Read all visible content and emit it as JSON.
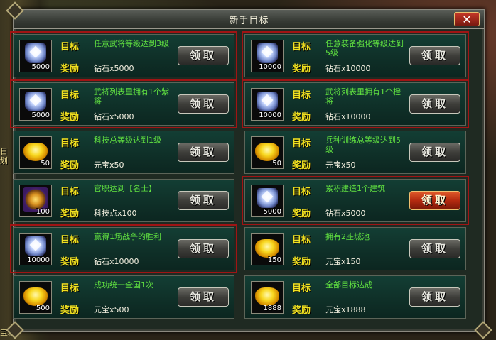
{
  "background": {
    "labels": [
      "日",
      "划",
      "宝箱"
    ]
  },
  "dialog": {
    "title": "新手目标",
    "close_label": "✕"
  },
  "labels": {
    "goal": "目标",
    "reward": "奖励"
  },
  "tasks": [
    {
      "icon": "diamond-icon",
      "qty": "5000",
      "goal": "任意武将等级达到3级",
      "reward": "钻石x5000",
      "button": "领取",
      "highlighted": true,
      "active": false
    },
    {
      "icon": "diamond-icon",
      "qty": "10000",
      "goal": "任意装备强化等级达到5级",
      "reward": "钻石x10000",
      "button": "领取",
      "highlighted": true,
      "active": false
    },
    {
      "icon": "diamond-icon",
      "qty": "5000",
      "goal": "武将列表里拥有1个紫将",
      "reward": "钻石x5000",
      "button": "领取",
      "highlighted": true,
      "active": false
    },
    {
      "icon": "diamond-icon",
      "qty": "10000",
      "goal": "武将列表里拥有1个橙将",
      "reward": "钻石x10000",
      "button": "领取",
      "highlighted": true,
      "active": false
    },
    {
      "icon": "gold-ingot-icon",
      "qty": "50",
      "goal": "科技总等级达到1级",
      "reward": "元宝x50",
      "button": "领取",
      "highlighted": false,
      "active": false
    },
    {
      "icon": "gold-ingot-icon",
      "qty": "50",
      "goal": "兵种训练总等级达到5级",
      "reward": "元宝x50",
      "button": "领取",
      "highlighted": false,
      "active": false
    },
    {
      "icon": "tech-point-icon",
      "qty": "100",
      "goal": "官职达到【名士】",
      "reward": "科技点x100",
      "button": "领取",
      "highlighted": false,
      "active": false
    },
    {
      "icon": "diamond-icon",
      "qty": "5000",
      "goal": "累积建造1个建筑",
      "reward": "钻石x5000",
      "button": "领取",
      "highlighted": true,
      "active": true
    },
    {
      "icon": "diamond-icon",
      "qty": "10000",
      "goal": "赢得1场战争的胜利",
      "reward": "钻石x10000",
      "button": "领取",
      "highlighted": true,
      "active": false
    },
    {
      "icon": "gold-ingot-icon",
      "qty": "150",
      "goal": "拥有2座城池",
      "reward": "元宝x150",
      "button": "领取",
      "highlighted": false,
      "active": false
    },
    {
      "icon": "gold-ingot-icon",
      "qty": "500",
      "goal": "成功统一全国1次",
      "reward": "元宝x500",
      "button": "领取",
      "highlighted": false,
      "active": false
    },
    {
      "icon": "gold-ingot-icon",
      "qty": "1888",
      "goal": "全部目标达成",
      "reward": "元宝x1888",
      "button": "领取",
      "highlighted": false,
      "active": false
    }
  ],
  "colors": {
    "goal_text": "#60e040",
    "label_text": "#f0e020",
    "highlight_border": "#a01414",
    "active_button": "#c43a18"
  }
}
